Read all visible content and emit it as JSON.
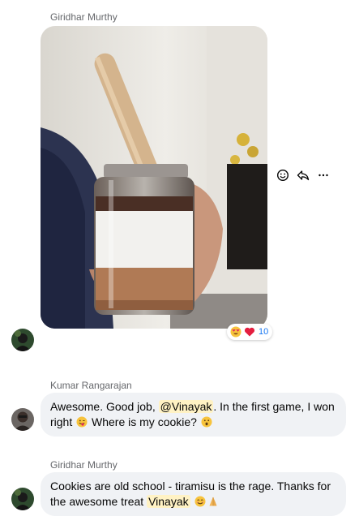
{
  "messages": [
    {
      "sender": "Giridhar Murthy",
      "type": "image",
      "reactions": {
        "count": "10",
        "emojis": [
          "heart-eyes",
          "red-heart"
        ]
      }
    },
    {
      "sender": "Kumar Rangarajan",
      "line1_pre": "Awesome. Good job, ",
      "mention": "@Vinayak",
      "line1_post": ". In the first game, I won",
      "line2_pre": "right ",
      "line2_mid": " Where is my cookie? "
    },
    {
      "sender": "Giridhar Murthy",
      "line1": "Cookies are old school - tiramisu is the rage. Thanks for",
      "line2_pre": "the awesome treat ",
      "mention": "Vinayak"
    }
  ],
  "actions": [
    "react-icon",
    "reply-icon",
    "more-icon"
  ],
  "colors": {
    "mention_bg": "#fff2c4",
    "bubble_bg": "#f0f2f5",
    "count": "#1877f2"
  }
}
